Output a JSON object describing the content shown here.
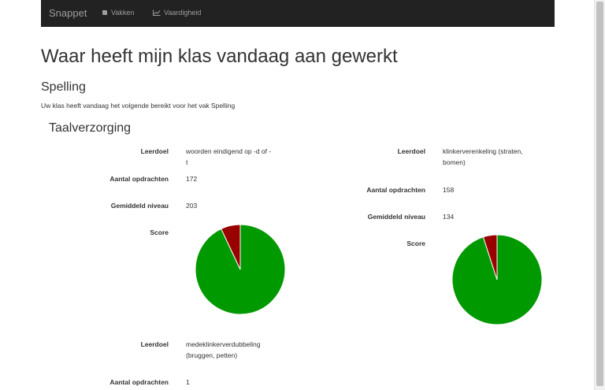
{
  "nav": {
    "brand": "Snappet",
    "items": [
      {
        "label": "Vakken",
        "icon": "book-icon"
      },
      {
        "label": "Vaardigheid",
        "icon": "line-chart-icon"
      }
    ]
  },
  "page": {
    "title": "Waar heeft mijn klas vandaag aan gewerkt",
    "section": "Spelling",
    "intro": "Uw klas heeft vandaag het volgende bereikt voor het vak Spelling",
    "subsection": "Taalverzorging"
  },
  "labels": {
    "leerdoel": "Leerdoel",
    "aantal": "Aantal opdrachten",
    "niveau": "Gemiddeld niveau",
    "score": "Score"
  },
  "goals": [
    {
      "leerdoel": "woorden eindigend op -d of -t",
      "aantal": "172",
      "niveau": "203",
      "score_fraction_correct": 0.93
    },
    {
      "leerdoel": "klinkerverenkeling (straten, bomen)",
      "aantal": "158",
      "niveau": "134",
      "score_fraction_correct": 0.95
    },
    {
      "leerdoel": "medeklinkerverdubbeling (bruggen, petten)",
      "aantal": "1"
    }
  ],
  "colors": {
    "correct": "#009900",
    "incorrect": "#990000",
    "navbar": "#222222"
  }
}
